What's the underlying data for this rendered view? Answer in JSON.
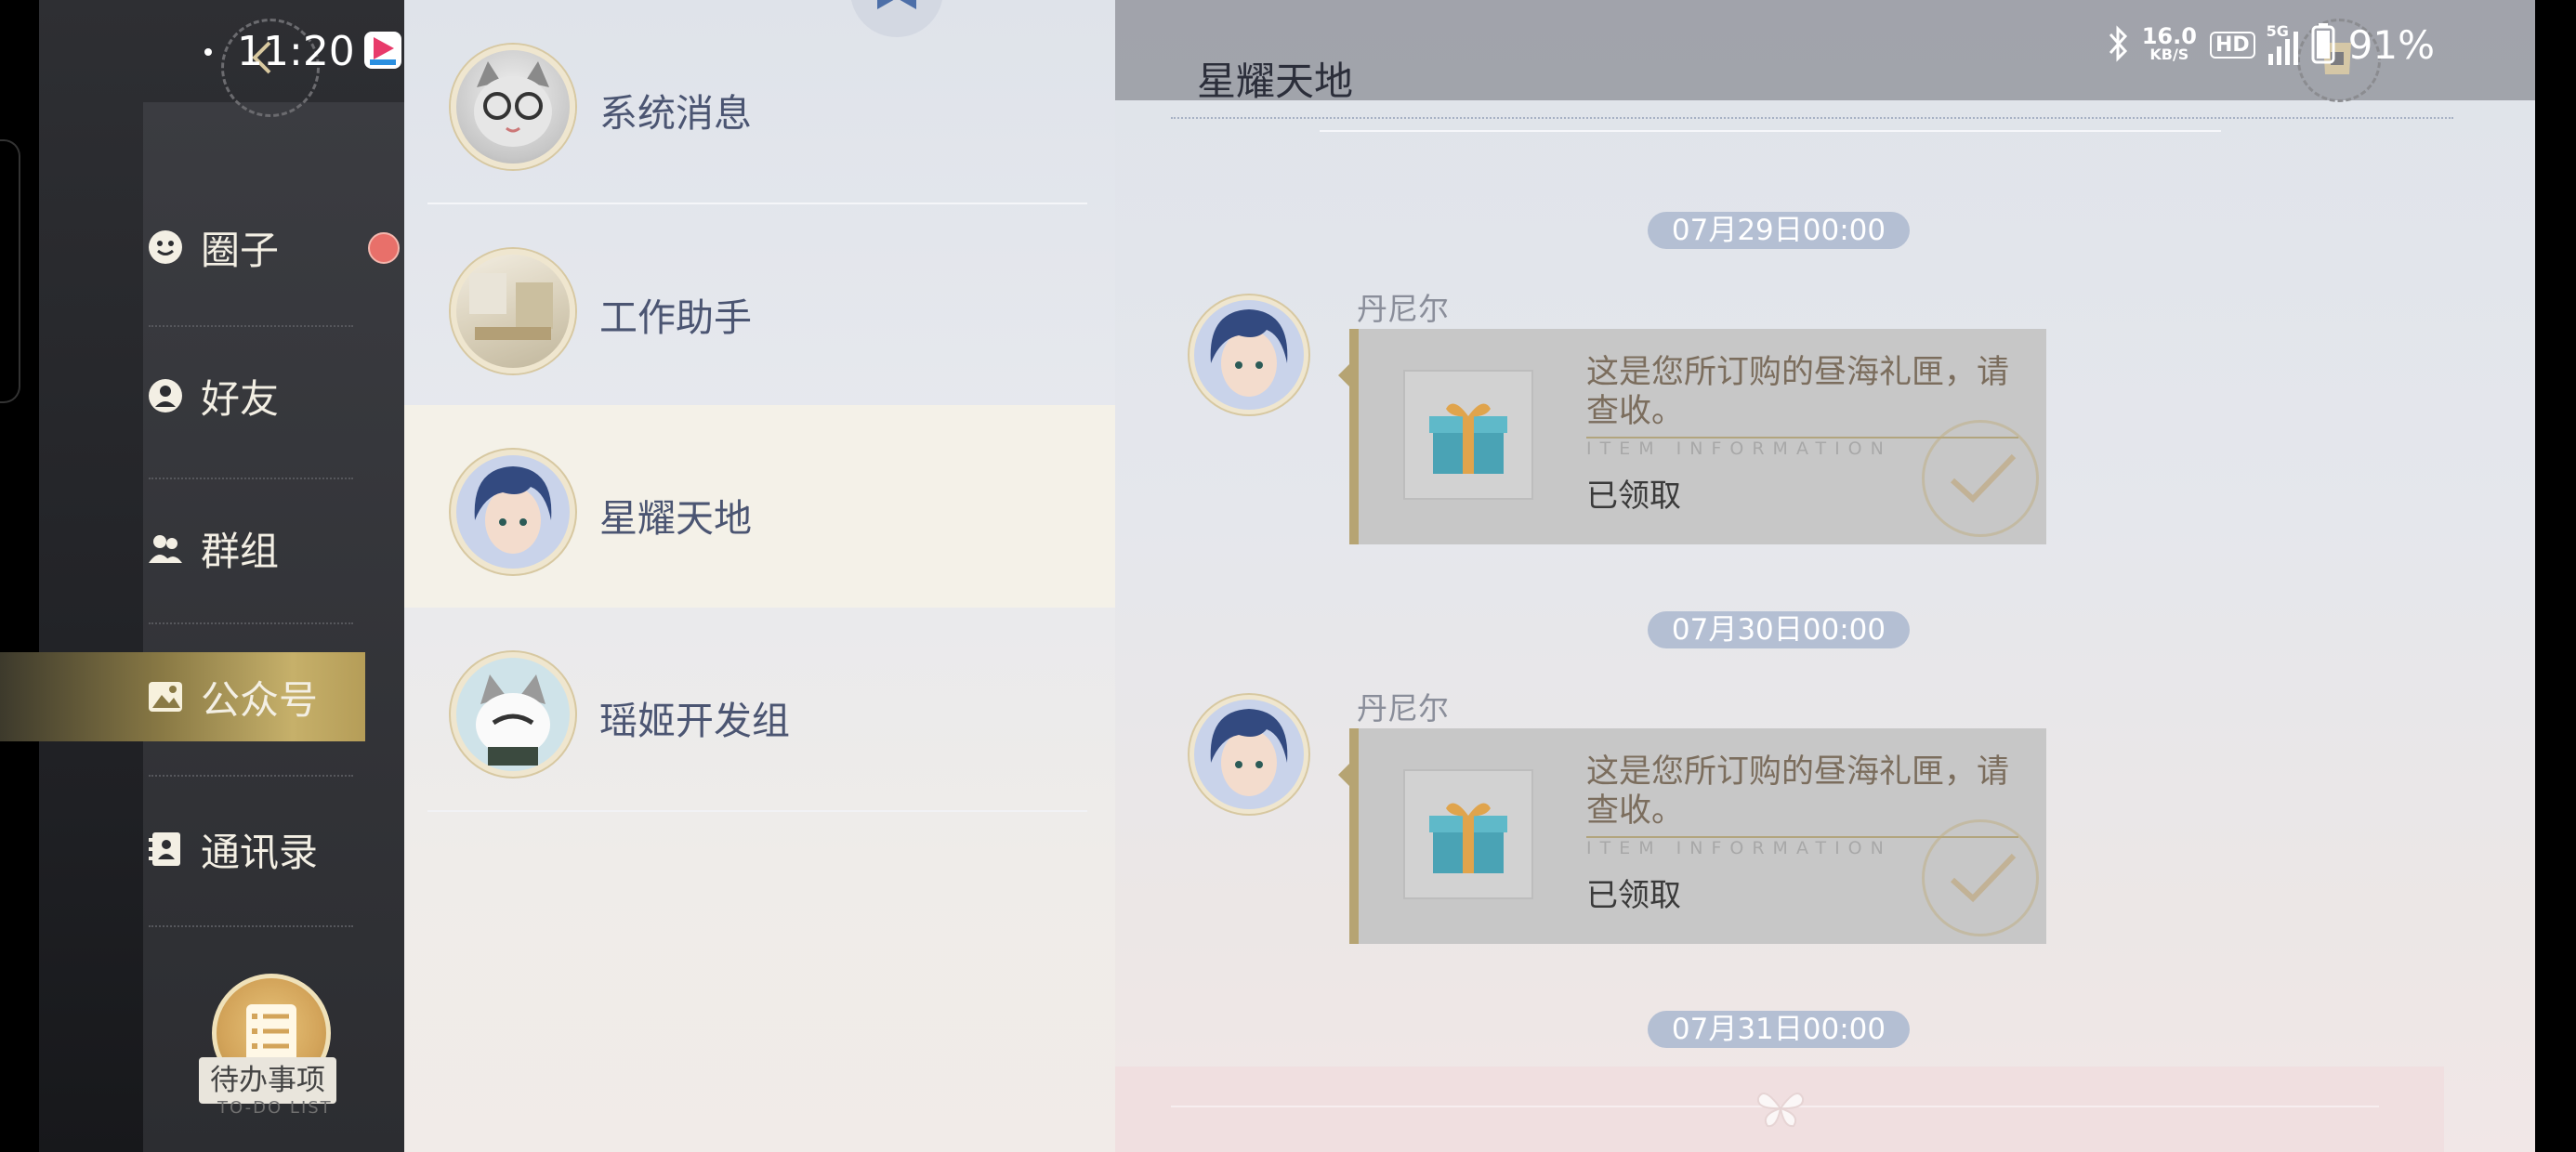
{
  "status_bar": {
    "time": "11:20",
    "net_speed_value": "16.0",
    "net_speed_unit": "KB/S",
    "hd_label": "HD",
    "network_type": "5G",
    "battery_percent": "91%"
  },
  "sidebar": {
    "items": [
      {
        "label": "圈子",
        "icon": "smile-icon",
        "has_badge": true
      },
      {
        "label": "好友",
        "icon": "friend-icon",
        "has_badge": false
      },
      {
        "label": "群组",
        "icon": "group-icon",
        "has_badge": false
      },
      {
        "label": "公众号",
        "icon": "image-icon",
        "active": true
      },
      {
        "label": "通讯录",
        "icon": "contacts-icon",
        "has_badge": false
      }
    ],
    "todo": {
      "label": "待办事项",
      "sublabel": "TO-DO LIST"
    }
  },
  "conversations": [
    {
      "name": "系统消息",
      "avatar": "cat-glasses-avatar"
    },
    {
      "name": "工作助手",
      "avatar": "room-avatar"
    },
    {
      "name": "星耀天地",
      "avatar": "blue-hair-avatar",
      "selected": true
    },
    {
      "name": "瑶姬开发组",
      "avatar": "cat-avatar"
    }
  ],
  "chat": {
    "title": "星耀天地",
    "messages": [
      {
        "date": "07月29日00:00",
        "sender": "丹尼尔",
        "text": "这是您所订购的昼海礼匣，请查收。",
        "info_label": "ITEM INFORMATION",
        "status": "已领取"
      },
      {
        "date": "07月30日00:00",
        "sender": "丹尼尔",
        "text": "这是您所订购的昼海礼匣，请查收。",
        "info_label": "ITEM INFORMATION",
        "status": "已领取"
      }
    ],
    "last_date": "07月31日00:00"
  },
  "colors": {
    "accent_gold": "#b6a473",
    "date_pill": "#b4bfd3",
    "badge_red": "#e8706a",
    "sidebar_dark": "#2c2d31"
  }
}
